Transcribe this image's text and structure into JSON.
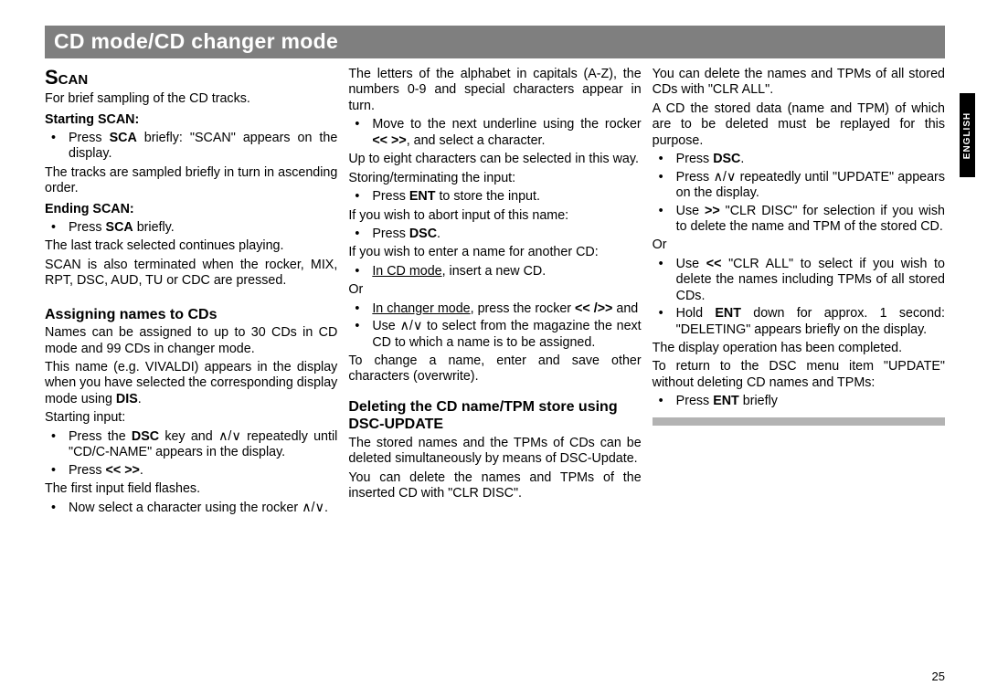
{
  "title": "CD mode/CD changer mode",
  "pageNum": "25",
  "sideTab": "ENGLISH",
  "col1": {
    "h_scan": "Scan",
    "p1": "For brief sampling of the CD tracks.",
    "sh1": "Starting SCAN:",
    "li1": "Press SCA briefly: \"SCAN\" appears on the display.",
    "p2": "The tracks are sampled briefly in turn in ascending order.",
    "sh2": "Ending SCAN:",
    "li2": "Press SCA briefly.",
    "p3": "The last track selected continues playing.",
    "p4": "SCAN is also terminated when the rocker, MIX, RPT, DSC, AUD, TU or CDC are pressed.",
    "h_assign": "Assigning names to CDs",
    "p5": "Names can be assigned to up to 30 CDs in CD mode and 99 CDs in changer mode.",
    "p6": "This name (e.g. VIVALDI) appears in the display when you have selected the corresponding display mode using DIS.",
    "p7": "Starting input:",
    "li3": "Press the DSC key and ∧/∨ repeatedly until \"CD/C-NAME\" appears in the display.",
    "li4": "Press << >>.",
    "p8": "The first input field flashes.",
    "li5": "Now select a character using the rocker ∧/∨."
  },
  "col2": {
    "p1": "The letters of the alphabet in capitals (A-Z), the numbers 0-9 and special characters appear in turn.",
    "li1": "Move to the next underline using the rocker << >>, and select a character.",
    "p2": "Up to eight characters can be selected in this way.",
    "p3": "Storing/terminating the input:",
    "li2": "Press ENT to store the input.",
    "p4": "If you wish to abort input of this name:",
    "li3": "Press DSC.",
    "p5": "If you wish to enter a name for another CD:",
    "li4": "In CD mode, insert a new CD.",
    "p6": "Or",
    "li5": "In changer mode, press the rocker << />> and",
    "li6": "Use ∧/∨ to select from the magazine the next CD to which a name is to be assigned.",
    "p7": "To change a name, enter and save other characters (overwrite).",
    "h_del": "Deleting the CD name/TPM store using DSC-UPDATE",
    "p8": "The stored names and the TPMs of CDs can be deleted simultaneously by means of DSC-Update.",
    "p9": "You can delete the names and TPMs of the inserted CD with \"CLR DISC\"."
  },
  "col3": {
    "p1": "You can delete the names and TPMs of all stored CDs with \"CLR ALL\".",
    "p2": "A CD the stored data (name and TPM) of which are to be deleted must be replayed for this purpose.",
    "li1": "Press DSC.",
    "li2": "Press ∧/∨ repeatedly until \"UPDATE\" appears on the display.",
    "li3": "Use >> \"CLR DISC\" for selection if you wish to delete the name and TPM of the stored CD.",
    "p3": "Or",
    "li4": "Use << \"CLR ALL\" to select if you wish to delete the names including TPMs of all stored CDs.",
    "li5": "Hold ENT down for approx. 1 second: \"DELETING\" appears briefly on the display.",
    "p4": "The display operation has been completed.",
    "p5": "To return to the DSC menu item \"UPDATE\" without deleting CD names and TPMs:",
    "li6": "Press ENT briefly"
  }
}
